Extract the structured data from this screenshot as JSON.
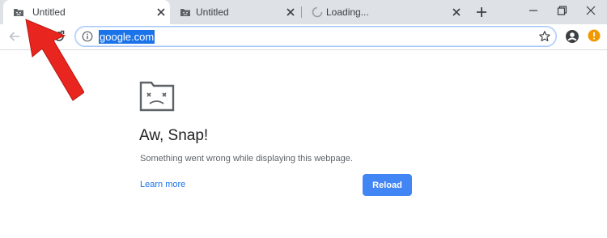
{
  "tabs": [
    {
      "label": "Untitled",
      "favicon": "sad-folder-icon",
      "active": true
    },
    {
      "label": "Untitled",
      "favicon": "sad-folder-icon",
      "active": false
    },
    {
      "label": "Loading...",
      "favicon": "loading-spinner-icon",
      "active": false
    }
  ],
  "window_controls": [
    "minimize-icon",
    "restore-icon",
    "close-icon"
  ],
  "omnibox": {
    "url": "google.com",
    "info_icon": "info-icon",
    "bookmark_icon": "star-icon"
  },
  "toolbar": {
    "back_icon": "back-arrow-icon",
    "forward_icon": "forward-arrow-icon",
    "reload_icon": "reload-icon",
    "profile_icon": "profile-icon",
    "alert_icon": "alert-icon"
  },
  "error_page": {
    "title": "Aw, Snap!",
    "message": "Something went wrong while displaying this webpage.",
    "learn_more": "Learn more",
    "reload": "Reload",
    "icon": "sad-page-icon"
  },
  "annotation": {
    "type": "arrow",
    "color": "#e8251e"
  },
  "colors": {
    "accent": "#1a73e8",
    "reload_button": "#4285f4",
    "tabstrip": "#dee1e6",
    "alert": "#f29900"
  }
}
